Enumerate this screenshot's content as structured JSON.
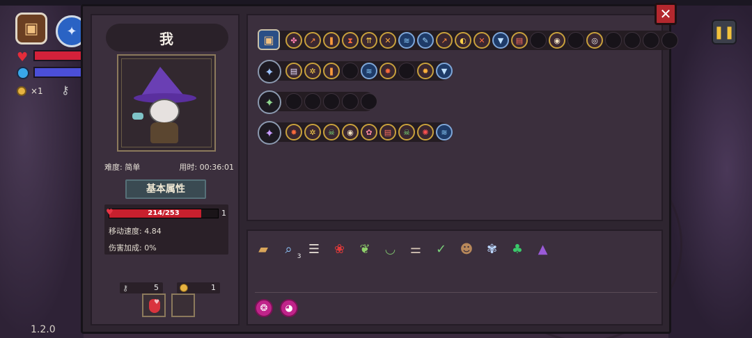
{
  "hud": {
    "coin_count": "×1",
    "version": "1.2.0"
  },
  "character": {
    "name": "我",
    "difficulty": "难度: 简单",
    "time": "用时: 00:36:01",
    "section_title": "基本属性",
    "hp_text": "214/253",
    "hp_value": 214,
    "hp_max": 253,
    "hp_extra": "1",
    "move_speed": "移动速度: 4.84",
    "damage_bonus": "伤害加成: 0%",
    "keys": "5",
    "coins": "1"
  },
  "wand_rows": [
    {
      "main_icon": "chest-icon",
      "slots": [
        "spell-a",
        "spell-b",
        "spell-c",
        "spell-d",
        "spell-e",
        "spell-f",
        "spell-g",
        "spell-h",
        "spell-i",
        "spell-j",
        "spell-k",
        "spell-l",
        "spell-m",
        "empty",
        "spell-n",
        "empty",
        "spell-o",
        "empty",
        "empty",
        "empty",
        "empty"
      ]
    },
    {
      "main_icon": "wand-blue-icon",
      "slots": [
        "spell-book",
        "spell-gear",
        "spell-pause",
        "empty",
        "spell-wave",
        "spell-fire",
        "empty",
        "spell-sun",
        "spell-shield"
      ]
    },
    {
      "main_icon": "wand-green-icon",
      "slots": [
        "empty",
        "empty",
        "empty",
        "empty",
        "empty"
      ]
    },
    {
      "main_icon": "wand-purple-icon",
      "slots": [
        "spell-fire",
        "spell-gear",
        "spell-skull",
        "spell-mouse",
        "spell-flower",
        "spell-chest",
        "spell-skull",
        "spell-spiral",
        "spell-wave"
      ]
    }
  ],
  "items": [
    {
      "icon": "scroll-icon",
      "count": ""
    },
    {
      "icon": "magnifier-icon",
      "count": "3"
    },
    {
      "icon": "ribcage-icon",
      "count": ""
    },
    {
      "icon": "rose-icon",
      "count": ""
    },
    {
      "icon": "leaf-icon",
      "count": ""
    },
    {
      "icon": "bowl-icon",
      "count": ""
    },
    {
      "icon": "bone-icon",
      "count": ""
    },
    {
      "icon": "sprout-icon",
      "count": ""
    },
    {
      "icon": "mask-icon",
      "count": ""
    },
    {
      "icon": "lotus-icon",
      "count": ""
    },
    {
      "icon": "clover-icon",
      "count": ""
    },
    {
      "icon": "witch-hat-icon",
      "count": ""
    }
  ],
  "buffs": [
    {
      "icon": "pink-swirl-icon"
    },
    {
      "icon": "pink-pig-icon"
    }
  ],
  "colors": {
    "panel_bg": "#2e2530",
    "hp_red": "#c8202e",
    "gold_border": "#c9a13c",
    "close_red": "#b3282e"
  }
}
